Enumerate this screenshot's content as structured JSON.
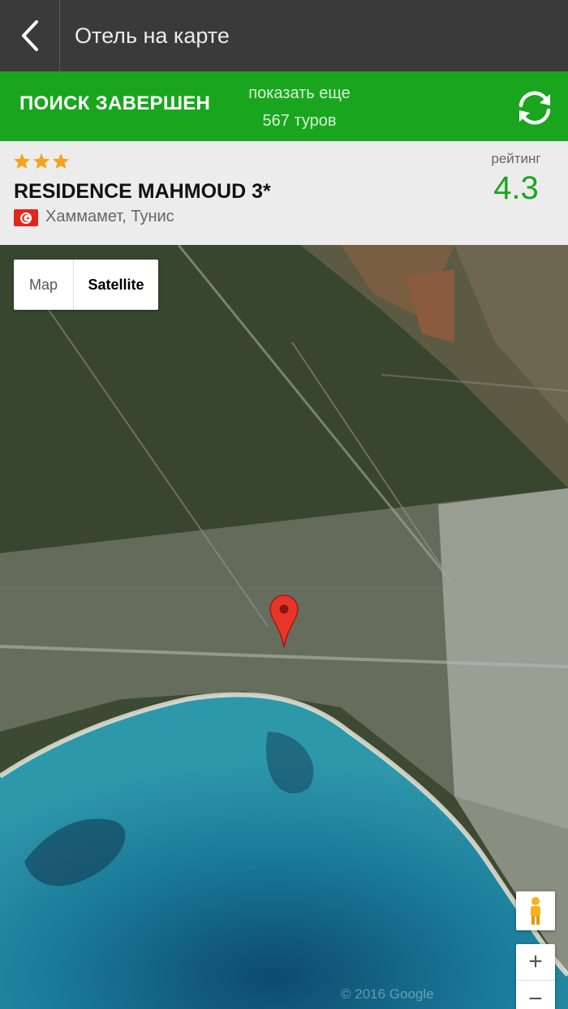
{
  "header": {
    "back_icon": "chevron-left-icon",
    "title": "Отель на карте"
  },
  "status_bar": {
    "search_done": "ПОИСК ЗАВЕРШЕН",
    "show_more_line1": "показать еще",
    "show_more_line2": "567 туров",
    "refresh_icon": "refresh-icon",
    "color": "#19a61e"
  },
  "hotel": {
    "stars": 3,
    "name": "RESIDENCE MAHMOUD 3*",
    "location": "Хаммамет, Тунис",
    "flag_icon": "tunisia-flag-icon",
    "rating_label": "рейтинг",
    "rating": "4.3",
    "rating_color": "#19a61e"
  },
  "map": {
    "type_map": "Map",
    "type_satellite": "Satellite",
    "selected_type": "Satellite",
    "pin_icon": "map-pin-icon",
    "pegman_icon": "pegman-icon",
    "zoom_in": "+",
    "zoom_out": "−",
    "copyright": "© 2016 Google"
  }
}
